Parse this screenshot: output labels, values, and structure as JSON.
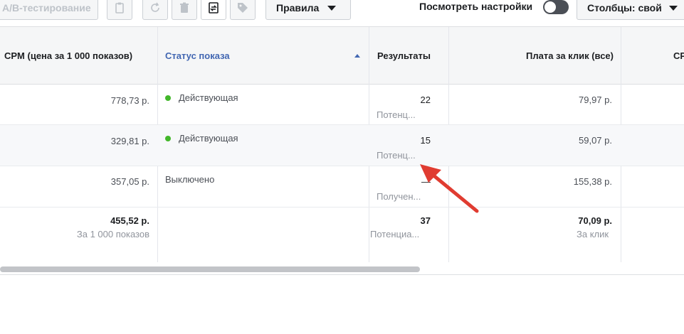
{
  "toolbar": {
    "ab_test_label": "A/B-тестирование",
    "rules_label": "Правила",
    "view_settings_label": "Посмотреть настройки",
    "columns_label": "Столбцы: свой"
  },
  "table": {
    "headers": {
      "cpm": "CPM (цена за 1 000 показов)",
      "status": "Статус показа",
      "results": "Результаты",
      "cpc": "Плата за клик (все)",
      "next": "СР"
    },
    "rows": [
      {
        "cpm": "778,73 р.",
        "status": "Действующая",
        "status_active": true,
        "results": "22",
        "results_sub": "Потенциальные клиенты",
        "cpc": "79,97 р."
      },
      {
        "cpm": "329,81 р.",
        "status": "Действующая",
        "status_active": true,
        "results": "15",
        "results_sub": "Потенциальные клиенты",
        "cpc": "59,07 р."
      },
      {
        "cpm": "357,05 р.",
        "status": "Выключено",
        "status_active": false,
        "results": "—",
        "results_sub": "Полученные",
        "cpc": "155,38 р."
      }
    ],
    "totals": {
      "cpm": "455,52 р.",
      "cpm_sub": "За 1 000 показов",
      "results": "37",
      "results_sub": "Потенциальные клиенты",
      "cpc": "70,09 р.",
      "cpc_sub": "За клик"
    }
  },
  "colors": {
    "active_dot": "#42b72a",
    "sort_header": "#4267b2",
    "annotation_arrow": "#e03c31"
  }
}
